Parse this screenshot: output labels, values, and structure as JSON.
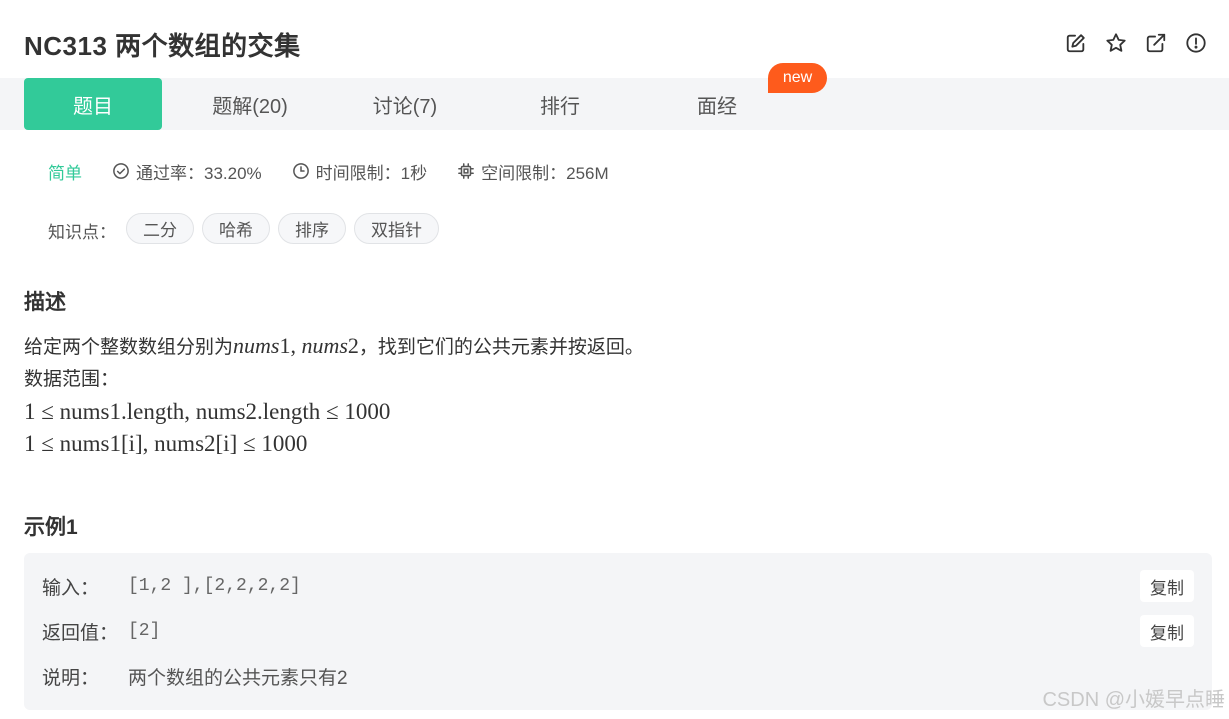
{
  "problem": {
    "title": "NC313  两个数组的交集"
  },
  "tabs": [
    {
      "label": "题目",
      "active": true
    },
    {
      "label": "题解(20)",
      "active": false
    },
    {
      "label": "讨论(7)",
      "active": false
    },
    {
      "label": "排行",
      "active": false
    },
    {
      "label": "面经",
      "active": false
    }
  ],
  "new_badge": "new",
  "meta": {
    "difficulty": "简单",
    "pass_rate": "通过率：33.20%",
    "time_limit": "时间限制：1秒",
    "space_limit": "空间限制：256M"
  },
  "tags": {
    "label": "知识点：",
    "items": [
      "二分",
      "哈希",
      "排序",
      "双指针"
    ]
  },
  "description": {
    "title": "描述",
    "line1_prefix": "给定两个整数数组分别为",
    "line1_var1": "nums",
    "line1_num1": "1",
    "line1_sep": ", ",
    "line1_var2": "nums",
    "line1_num2": "2",
    "line1_suffix": "，找到它们的公共元素并按返回。",
    "range_label": "数据范围：",
    "constraint1": "1 ≤ nums1.length, nums2.length ≤ 1000",
    "constraint2": "1 ≤ nums1[i], nums2[i] ≤ 1000"
  },
  "example": {
    "title": "示例1",
    "input_label": "输入：",
    "input_value": "[1,2 ],[2,2,2,2]",
    "output_label": "返回值：",
    "output_value": "[2]",
    "explain_label": "说明：",
    "explain_value": "两个数组的公共元素只有2",
    "copy_label": "复制"
  },
  "watermark": "CSDN @小媛早点睡",
  "colors": {
    "accent": "#32ca99",
    "badge": "#fe5b1c"
  }
}
